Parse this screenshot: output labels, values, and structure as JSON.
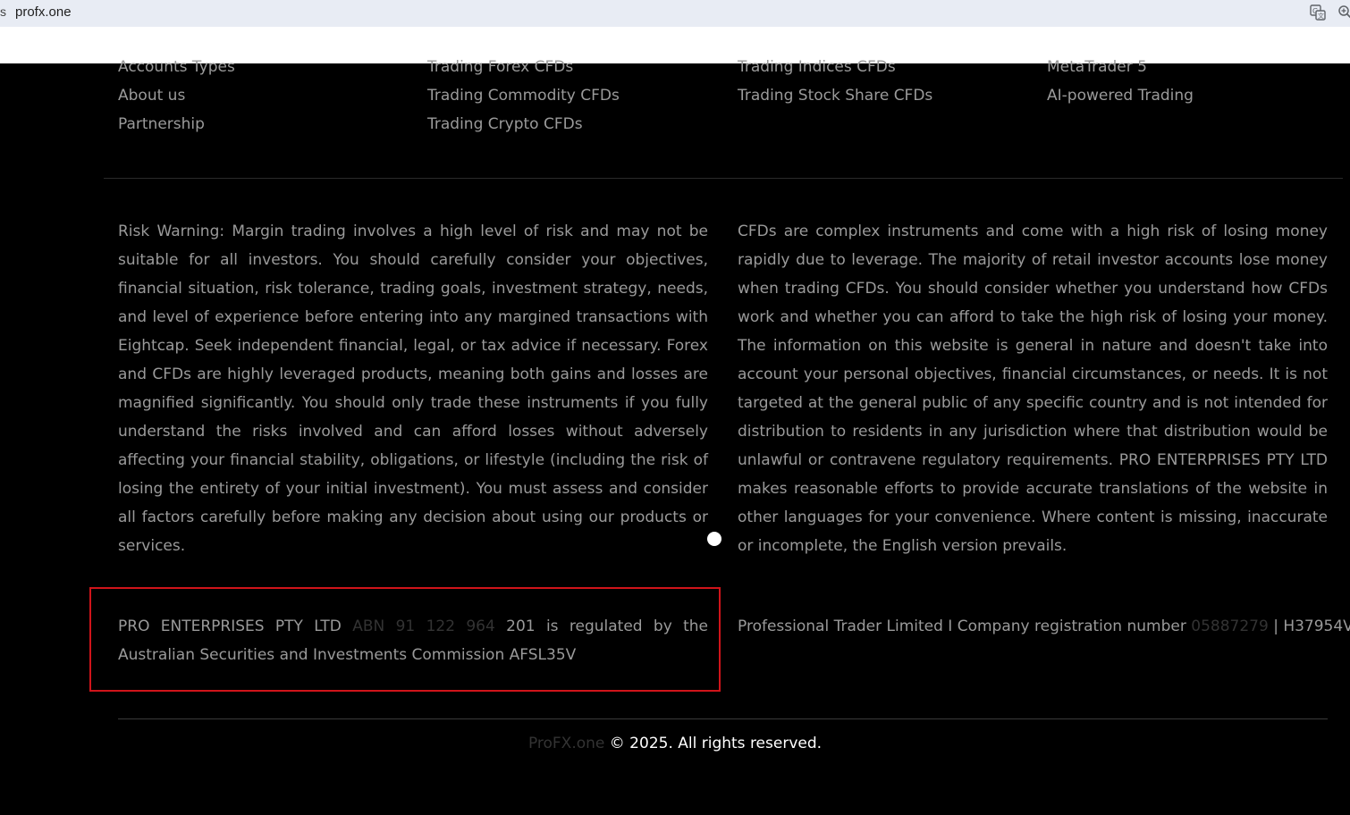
{
  "browser": {
    "edge_char": "s",
    "url": "profx.one"
  },
  "footer": {
    "columns": [
      [
        "Accounts Types",
        "About us",
        "Partnership"
      ],
      [
        "Trading Forex CFDs",
        "Trading Commodity CFDs",
        "Trading Crypto CFDs"
      ],
      [
        "Trading Indices CFDs",
        "Trading Stock Share CFDs"
      ],
      [
        "MetaTrader 5",
        "AI-powered Trading"
      ]
    ],
    "risk_warning": "Risk Warning: Margin trading involves a high level of risk and may not be suitable for all investors. You should carefully consider your objectives, financial situation, risk tolerance, trading goals, investment strategy, needs, and level of experience before entering into any margined transactions with Eightcap. Seek independent financial, legal, or tax advice if necessary. Forex and CFDs are highly leveraged products, meaning both gains and losses are magnified significantly. You should only trade these instruments if you fully understand the risks involved and can afford losses without adversely affecting your financial stability, obligations, or lifestyle (including the risk of losing the entirety of your initial investment). You must assess and consider all factors carefully before making any decision about using our products or services.",
    "cfd_warning": "CFDs are complex instruments and come with a high risk of losing money rapidly due to leverage. The majority of retail investor accounts lose money when trading CFDs. You should consider whether you understand how CFDs work and whether you can afford to take the high risk of losing your money. The information on this website is general in nature and doesn't take into account your personal objectives, financial circumstances, or needs. It is not targeted at the general public of any specific country and is not intended for distribution to residents in any jurisdiction where that distribution would be unlawful or contravene regulatory requirements. PRO ENTERPRISES PTY LTD makes reasonable efforts to provide accurate translations of the website in other languages for your convenience. Where content is missing, inaccurate or incomplete, the English version prevails.",
    "regulation_left": {
      "company": "PRO ENTERPRISES PTY LTD",
      "abn_dim": "ABN 91 122 964",
      "rest": "201 is regulated by the Australian Securities and Investments Commission AFSL35V"
    },
    "regulation_right": {
      "text": "Professional Trader Limited I Company registration number",
      "number_dim": "05887279",
      "suffix": "| H37954V"
    },
    "copyright": {
      "brand": "ProFX.one",
      "text": "© 2025. All rights reserved."
    }
  },
  "colors": {
    "background": "#000000",
    "text": "#9a9a9a",
    "highlight_border": "#d0141a",
    "address_bar": "#e8ecf4"
  }
}
